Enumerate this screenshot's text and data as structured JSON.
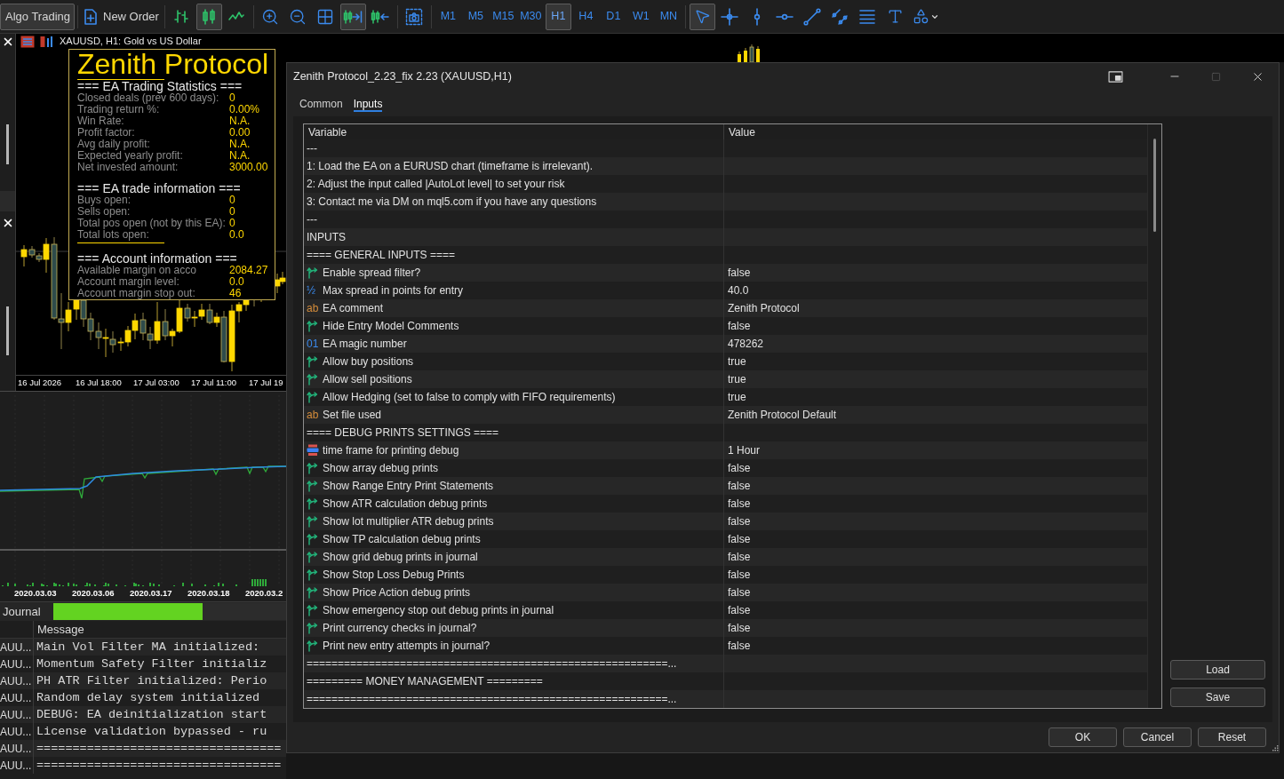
{
  "toolbar": {
    "algo_trading": {
      "label": "Algo Trading",
      "on": true
    },
    "new_order": {
      "label": "New Order"
    },
    "chart_types": [
      {
        "selected": false
      },
      {
        "selected": true
      },
      {
        "selected": false
      }
    ],
    "view_toggles": [
      {
        "on": true
      },
      {
        "on": false
      }
    ],
    "timeframes": [
      {
        "label": "M1",
        "selected": false
      },
      {
        "label": "M5",
        "selected": false
      },
      {
        "label": "M15",
        "selected": false
      },
      {
        "label": "M30",
        "selected": false
      },
      {
        "label": "H1",
        "selected": true
      },
      {
        "label": "H4",
        "selected": false
      },
      {
        "label": "D1",
        "selected": false
      },
      {
        "label": "W1",
        "selected": false
      },
      {
        "label": "MN",
        "selected": false
      }
    ],
    "drawing_tools": [
      {
        "selected": true
      },
      {
        "selected": false
      },
      {
        "selected": false
      },
      {
        "selected": false
      },
      {
        "selected": false
      },
      {
        "selected": false
      },
      {
        "selected": false
      },
      {
        "selected": false
      },
      {
        "selected": false
      }
    ]
  },
  "chart": {
    "title": "XAUUSD, H1: Gold vs US Dollar",
    "overlay": {
      "title": "Zenith Protocol",
      "sections": [
        {
          "heading": "=== EA Trading Statistics ===",
          "underlined": false,
          "rows": [
            {
              "label": "Closed deals (prev 600 days):",
              "value": "0"
            },
            {
              "label": "Trading return %:",
              "value": "0.00%"
            },
            {
              "label": "Win Rate:",
              "value": "N.A."
            },
            {
              "label": "Profit factor:",
              "value": "0.00"
            },
            {
              "label": "Avg daily profit:",
              "value": "N.A."
            },
            {
              "label": "Expected yearly profit:",
              "value": "N.A."
            },
            {
              "label": "Net invested amount:",
              "value": "3000.00"
            }
          ]
        },
        {
          "heading": "=== EA trade information ===",
          "underlined": true,
          "rows": [
            {
              "label": "Buys open:",
              "value": "0"
            },
            {
              "label": "Sells open:",
              "value": "0"
            },
            {
              "label": "Total pos open (not by this EA):",
              "value": "0"
            },
            {
              "label": "Total lots open:",
              "value": "0.0"
            }
          ]
        },
        {
          "heading": "=== Account information ===",
          "underlined": false,
          "rows": [
            {
              "label": "Available margin on acco",
              "value": "2084.27"
            },
            {
              "label": "Account margin level:",
              "value": "0.0"
            },
            {
              "label": "Account margin stop out:",
              "value": "46"
            }
          ]
        }
      ]
    },
    "time_labels": [
      "16 Jul 2026",
      "16 Jul 18:00",
      "17 Jul 03:00",
      "17 Jul 11:00",
      "17 Jul 19"
    ]
  },
  "equity_chart": {
    "date_labels": [
      "2020.03.03",
      "2020.03.06",
      "2020.03.17",
      "2020.03.18",
      "2020.03.2"
    ]
  },
  "journal": {
    "tab": "Journal",
    "progress": {
      "level": 0.64
    },
    "message_header": "Message",
    "rows": [
      {
        "symbol": "AUU...",
        "message": "Main Vol Filter MA initialized:"
      },
      {
        "symbol": "AUU...",
        "message": "Momentum Safety Filter initializ"
      },
      {
        "symbol": "AUU...",
        "message": "PH ATR Filter initialized: Perio"
      },
      {
        "symbol": "AUU...",
        "message": "Random delay system initialized"
      },
      {
        "symbol": "AUU...",
        "message": "DEBUG: EA deinitialization start"
      },
      {
        "symbol": "AUU...",
        "message": "License validation bypassed - ru"
      },
      {
        "symbol": "AUU...",
        "message": "=================================="
      },
      {
        "symbol": "AUU...",
        "message": "=================================="
      }
    ]
  },
  "dialog": {
    "title": "Zenith Protocol_2.23_fix 2.23 (XAUUSD,H1)",
    "maximize": {
      "disabled": true
    },
    "tabs": [
      {
        "label": "Common",
        "selected": false
      },
      {
        "label": "Inputs",
        "selected": true
      }
    ],
    "table": {
      "columns": [
        "Variable",
        "Value"
      ],
      "rows": [
        {
          "kind": "text",
          "variable": "---"
        },
        {
          "kind": "text",
          "variable": "1: Load the EA on a EURUSD chart (timeframe is irrelevant)."
        },
        {
          "kind": "text",
          "variable": "2: Adjust the input called |AutoLot level| to set your risk"
        },
        {
          "kind": "text",
          "variable": "3: Contact me via DM on mql5.com if you have any questions"
        },
        {
          "kind": "text",
          "variable": "---"
        },
        {
          "kind": "text",
          "variable": "INPUTS"
        },
        {
          "kind": "text",
          "variable": "==== GENERAL INPUTS ===="
        },
        {
          "kind": "bool",
          "variable": "Enable spread filter?",
          "value": "false"
        },
        {
          "kind": "double",
          "type_mark": "½",
          "variable": "Max spread in points for entry",
          "value": "40.0"
        },
        {
          "kind": "string",
          "type_mark": "ab",
          "variable": "EA comment",
          "value": "Zenith Protocol"
        },
        {
          "kind": "bool",
          "variable": "Hide Entry Model Comments",
          "value": "false"
        },
        {
          "kind": "int",
          "type_mark": "01",
          "variable": "EA magic number",
          "value": "478262"
        },
        {
          "kind": "bool",
          "variable": "Allow buy positions",
          "value": "true"
        },
        {
          "kind": "bool",
          "variable": "Allow sell positions",
          "value": "true"
        },
        {
          "kind": "bool",
          "variable": "Allow Hedging (set to false to comply with FIFO requirements)",
          "value": "true"
        },
        {
          "kind": "string",
          "type_mark": "ab",
          "variable": "Set file used",
          "value": "Zenith Protocol Default"
        },
        {
          "kind": "text",
          "variable": "==== DEBUG PRINTS SETTINGS ===="
        },
        {
          "kind": "enum",
          "variable": "time frame for printing debug",
          "value": "1 Hour"
        },
        {
          "kind": "bool",
          "variable": "Show array debug prints",
          "value": "false"
        },
        {
          "kind": "bool",
          "variable": "Show Range Entry Print Statements",
          "value": "false"
        },
        {
          "kind": "bool",
          "variable": "Show ATR calculation debug prints",
          "value": "false"
        },
        {
          "kind": "bool",
          "variable": "Show lot multiplier ATR debug prints",
          "value": "false"
        },
        {
          "kind": "bool",
          "variable": "Show TP calculation debug prints",
          "value": "false"
        },
        {
          "kind": "bool",
          "variable": "Show grid debug prints in journal",
          "value": "false"
        },
        {
          "kind": "bool",
          "variable": "Show Stop Loss Debug Prints",
          "value": "false"
        },
        {
          "kind": "bool",
          "variable": "Show Price Action debug prints",
          "value": "false"
        },
        {
          "kind": "bool",
          "variable": "Show emergency stop out debug prints in journal",
          "value": "false"
        },
        {
          "kind": "bool",
          "variable": "Print currency checks in journal?",
          "value": "false"
        },
        {
          "kind": "bool",
          "variable": "Print new entry attempts in journal?",
          "value": "false"
        },
        {
          "kind": "text",
          "variable": "==========================================================..."
        },
        {
          "kind": "text",
          "variable": "========= MONEY MANAGEMENT ========="
        },
        {
          "kind": "text",
          "variable": "==========================================================..."
        }
      ]
    },
    "side_buttons": [
      "Load",
      "Save"
    ],
    "buttons": [
      "OK",
      "Cancel",
      "Reset"
    ]
  }
}
